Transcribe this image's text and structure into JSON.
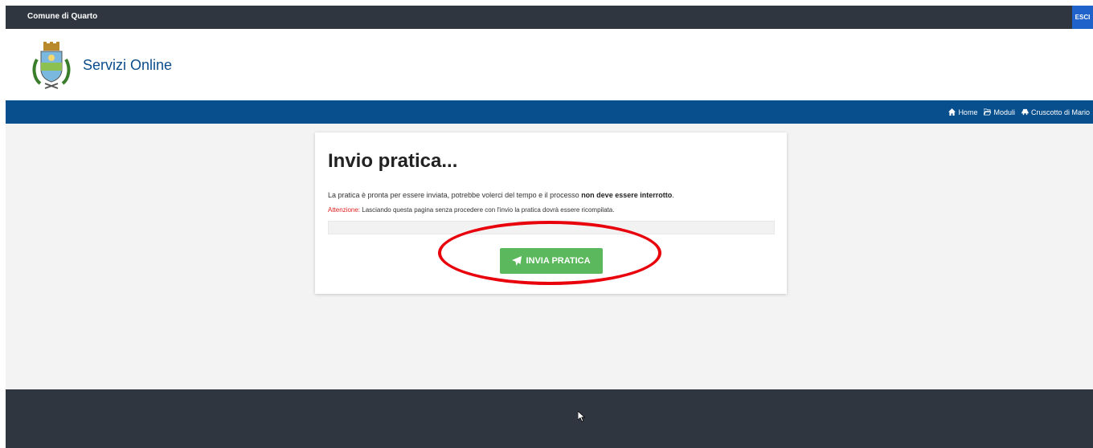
{
  "topbar": {
    "ente": "Comune di Quarto",
    "logout": "ESCI"
  },
  "brand": {
    "title": "Servizi Online",
    "crest_icon": "crest-icon"
  },
  "nav": {
    "home": "Home",
    "moduli": "Moduli",
    "dashboard": "Cruscotto di Mario"
  },
  "card": {
    "title": "Invio pratica...",
    "text_before": "La pratica è pronta per essere inviata, potrebbe volerci del tempo e il processo ",
    "text_bold": "non deve essere interrotto",
    "text_after": ".",
    "warning_label": "Attenzione:",
    "warning_text": " Lasciando questa pagina senza procedere con l'invio la pratica dovrà essere ricompilata.",
    "progress": 0,
    "send_button": "INVIA PRATICA"
  },
  "colors": {
    "topbar": "#2f3640",
    "navbar": "#084f8e",
    "brand_text": "#0b4d8c",
    "button": "#5cb85c",
    "warning": "#e02020",
    "highlight": "#e8000b"
  }
}
